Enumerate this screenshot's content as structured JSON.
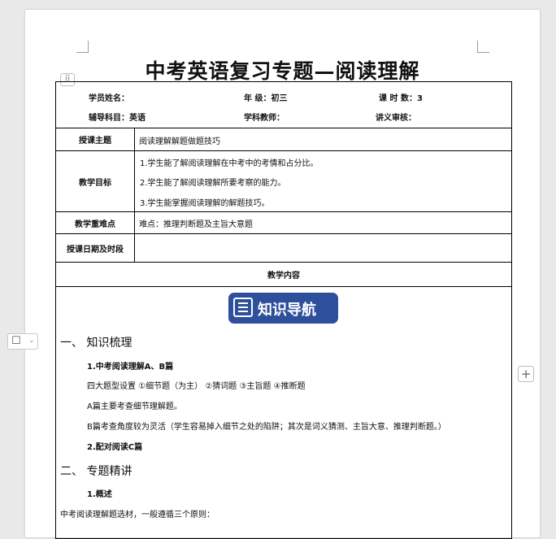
{
  "document": {
    "title": "中考英语复习专题—阅读理解",
    "info": {
      "student_name": "学员姓名：",
      "grade": "年    级：初三",
      "lessons": "课 时 数：3",
      "subject": "辅导科目：英语",
      "teacher": "学科教师：",
      "review": "讲义审核："
    },
    "rows": {
      "topic_label": "授课主题",
      "topic_value": "阅读理解解题做题技巧",
      "goals_label": "教学目标",
      "goals": [
        "1.学生能了解阅读理解在中考中的考情和占分比。",
        "2.学生能了解阅读理解所要考察的能力。",
        "3.学生能掌握阅读理解的解题技巧。"
      ],
      "keypoints_label": "教学重难点",
      "keypoints_value": "难点：推理判断题及主旨大意题",
      "schedule_label": "授课日期及时段",
      "content_title": "教学内容"
    },
    "content": {
      "banner": "知识导航",
      "section1": "一、  知识梳理",
      "sub1": "1.中考阅读理解A、B篇",
      "line1": "四大题型设置  ①细节题（为主）    ②猜词题      ③主旨题        ④推断题",
      "line2": "A篇主要考查细节理解题。",
      "line3": "B篇考查角度较为灵活（学生容易掉入细节之处的陷阱；其次是词义猜测、主旨大意、推理判断题。）",
      "sub2": "2.配对阅读C篇",
      "section2": "二、  专题精讲",
      "sub3": "1.概述",
      "line4": "中考阅读理解题选材，一般遵循三个原则："
    }
  },
  "toolbar": {
    "handle_icon": "drag-handle-icon",
    "side_icon": "paragraph-icon",
    "plus_icon": "plus-icon"
  }
}
